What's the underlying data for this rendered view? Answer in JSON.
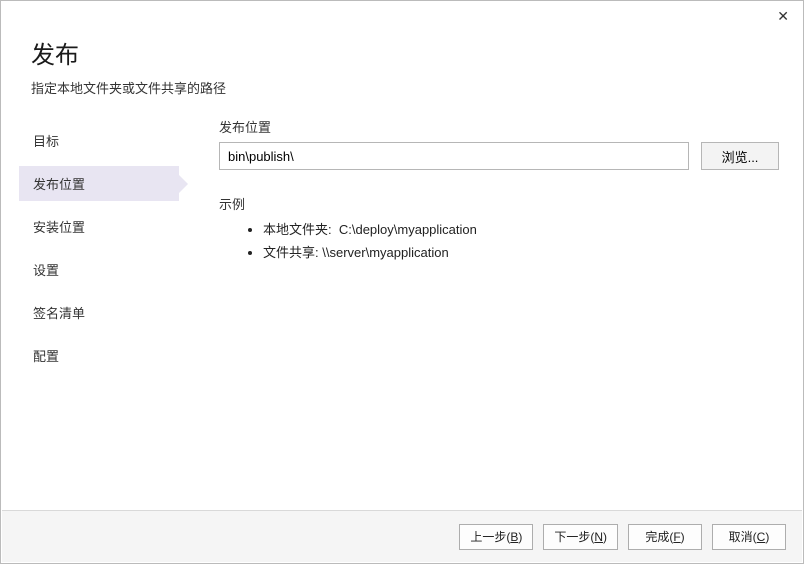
{
  "window": {
    "close": "✕"
  },
  "header": {
    "title": "发布",
    "subtitle": "指定本地文件夹或文件共享的路径"
  },
  "sidebar": {
    "items": [
      {
        "label": "目标",
        "selected": false
      },
      {
        "label": "发布位置",
        "selected": true
      },
      {
        "label": "安装位置",
        "selected": false
      },
      {
        "label": "设置",
        "selected": false
      },
      {
        "label": "签名清单",
        "selected": false
      },
      {
        "label": "配置",
        "selected": false
      }
    ]
  },
  "main": {
    "location_label": "发布位置",
    "location_value": "bin\\publish\\",
    "browse_label": "浏览...",
    "example_label": "示例",
    "examples": [
      {
        "name": "本地文件夹:",
        "value": "C:\\deploy\\myapplication"
      },
      {
        "name": "文件共享:",
        "value": "\\\\server\\myapplication"
      }
    ]
  },
  "footer": {
    "back": {
      "text": "上一步(",
      "key": "B",
      "tail": ")"
    },
    "next": {
      "text": "下一步(",
      "key": "N",
      "tail": ")"
    },
    "finish": {
      "text": "完成(",
      "key": "F",
      "tail": ")"
    },
    "cancel": {
      "text": "取消(",
      "key": "C",
      "tail": ")"
    }
  }
}
